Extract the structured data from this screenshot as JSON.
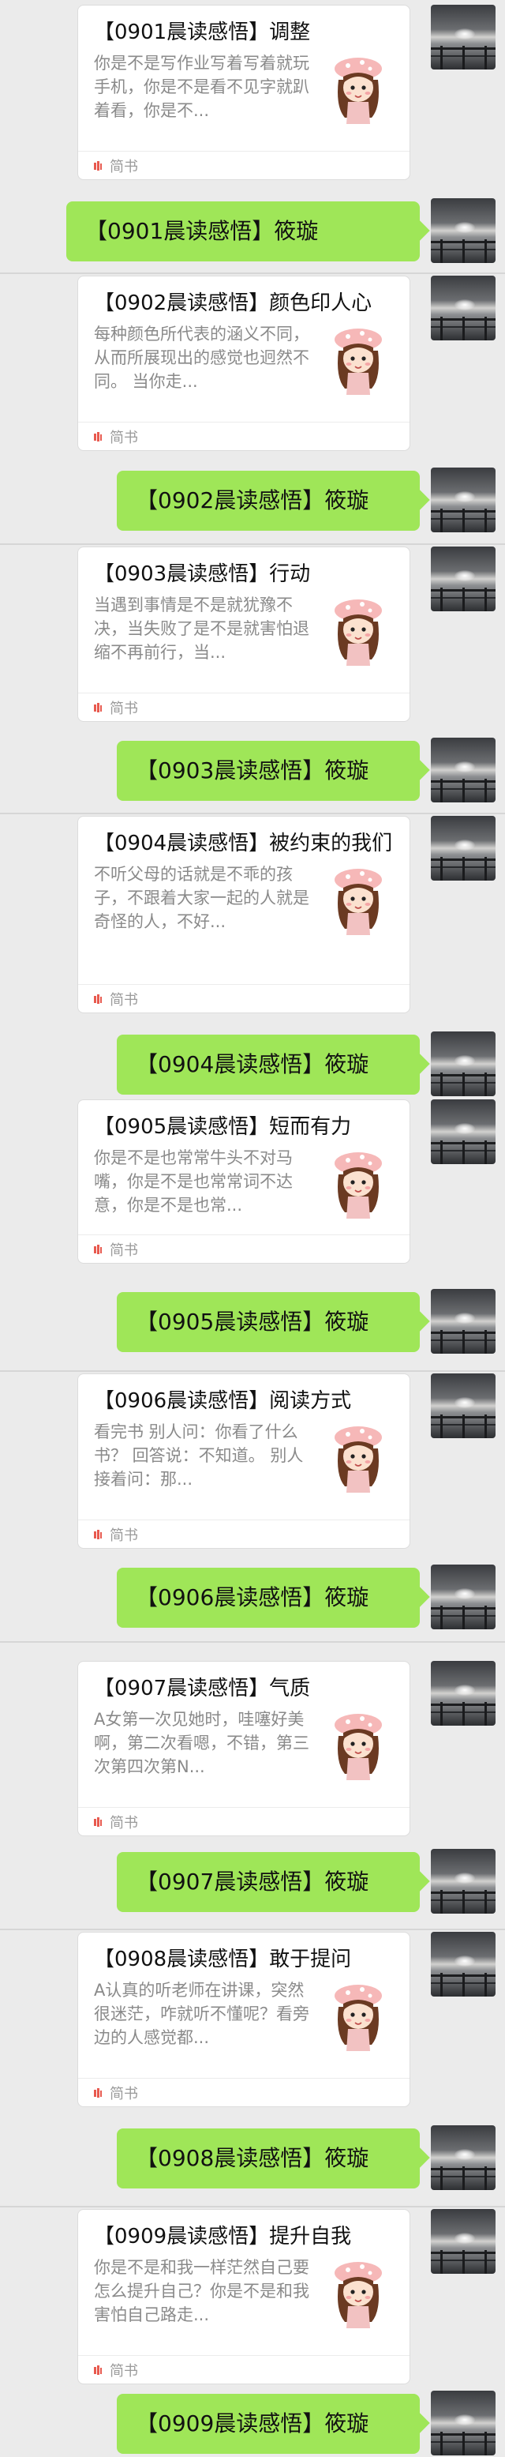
{
  "source_name": "简书",
  "messages": [
    {
      "title": "【0901晨读感悟】调整",
      "desc": "你是不是写作业写着写着就玩手机，你是不是看不见字就趴着看，你是不...",
      "reply": "【0901晨读感悟】筱璇"
    },
    {
      "title": "【0902晨读感悟】颜色印人心",
      "desc": "每种颜色所代表的涵义不同，从而所展现出的感觉也迥然不同。 当你走...",
      "reply": "【0902晨读感悟】筱璇"
    },
    {
      "title": "【0903晨读感悟】行动",
      "desc": "当遇到事情是不是就犹豫不决，当失败了是不是就害怕退缩不再前行，当...",
      "reply": "【0903晨读感悟】筱璇"
    },
    {
      "title": "【0904晨读感悟】被约束的我们",
      "desc": "不听父母的话就是不乖的孩子，不跟着大家一起的人就是奇怪的人，不好...",
      "reply": "【0904晨读感悟】筱璇"
    },
    {
      "title": "【0905晨读感悟】短而有力",
      "desc": "你是不是也常常牛头不对马嘴，你是不是也常常词不达意，你是不是也常...",
      "reply": "【0905晨读感悟】筱璇"
    },
    {
      "title": "【0906晨读感悟】阅读方式",
      "desc": "看完书 别人问：你看了什么书？ 回答说：不知道。 别人接着问：那...",
      "reply": "【0906晨读感悟】筱璇"
    },
    {
      "title": "【0907晨读感悟】气质",
      "desc": "A女第一次见她时，哇噻好美啊，第二次看嗯，不错，第三次第四次第N...",
      "reply": "【0907晨读感悟】筱璇"
    },
    {
      "title": "【0908晨读感悟】敢于提问",
      "desc": "A认真的听老师在讲课，突然很迷茫，咋就听不懂呢？看旁边的人感觉都...",
      "reply": "【0908晨读感悟】筱璇"
    },
    {
      "title": "【0909晨读感悟】提升自我",
      "desc": "你是不是和我一样茫然自己要怎么提升自己？你是不是和我害怕自己路走...",
      "reply": "【0909晨读感悟】筱璇"
    }
  ]
}
